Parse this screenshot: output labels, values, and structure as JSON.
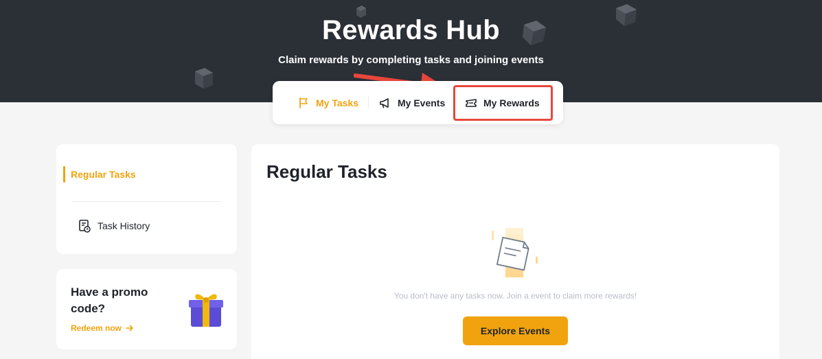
{
  "hero": {
    "title": "Rewards Hub",
    "subtitle": "Claim rewards by completing tasks and joining events"
  },
  "tabs": [
    {
      "label": "My Tasks",
      "icon": "flag-icon",
      "active": true
    },
    {
      "label": "My Events",
      "icon": "megaphone-icon",
      "active": false
    },
    {
      "label": "My Rewards",
      "icon": "ticket-icon",
      "active": false,
      "highlighted": true
    }
  ],
  "sidebar": {
    "items": [
      {
        "label": "Regular Tasks",
        "active": true
      },
      {
        "label": "Task History",
        "icon": "task-history-icon",
        "active": false
      }
    ]
  },
  "promo": {
    "title": "Have a promo code?",
    "link_label": "Redeem now",
    "icon": "gift-icon"
  },
  "main": {
    "title": "Regular Tasks",
    "empty_message": "You don't have any tasks now. Join a event to claim more rewards!",
    "explore_button": "Explore Events",
    "empty_icon": "empty-paper-icon"
  },
  "colors": {
    "accent": "#f0a30e",
    "hero_bg": "#2b2f36",
    "page_bg": "#f5f5f5",
    "highlight": "#e8473c"
  }
}
